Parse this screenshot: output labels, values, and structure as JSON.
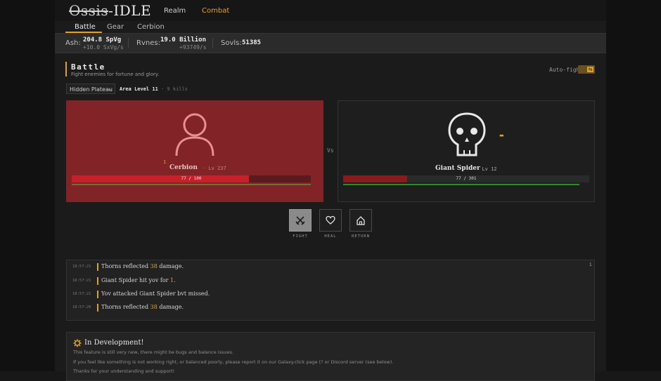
{
  "app": {
    "logo": "Ossis-IDLE",
    "logo_struck": "Ossis",
    "logo_rest": "-IDLE"
  },
  "topnav": {
    "realm": "Realm",
    "combat": "Combat"
  },
  "subtabs": {
    "battle": "Battle",
    "gear": "Gear",
    "cerbion": "Cerbion"
  },
  "resources": {
    "ash": {
      "label": "Ash:",
      "value": "204.8 SpVg",
      "rate": "+10.0 SxVg/s"
    },
    "runes": {
      "label": "Rvnes:",
      "value": "19.0 Billion",
      "rate": "+93749/s"
    },
    "souls": {
      "label": "Sovls:",
      "value": "51385"
    }
  },
  "battle": {
    "title": "Battle",
    "subtitle": "Fight enemies for fortune and glory.",
    "autofight_label": "Auto-fight:",
    "area": "Hidden Plateau",
    "area_level": "Area Level 11",
    "area_kills": "· 9 kills",
    "vs": "Vs"
  },
  "player": {
    "name": "Cerbion",
    "level": "· Lv 237",
    "hp_text": "77 / 100",
    "hp_fraction": 0.74,
    "marker": "1"
  },
  "enemy": {
    "name": "Giant Spider",
    "level": "· Lv 12",
    "hp_text": "77 / 301",
    "hp_fraction": 0.26
  },
  "actions": {
    "fight": "FIGHT",
    "heal": "HEAL",
    "return": "RETURN"
  },
  "log": [
    {
      "time": "18:57:21",
      "pre": "Thorns reflected ",
      "hi": "38",
      "post": " damage."
    },
    {
      "time": "18:57:21",
      "pre": "Giant Spider hit yov for ",
      "hi": "1",
      "post": "."
    },
    {
      "time": "18:57:21",
      "pre": "Yov attacked Giant Spider bvt missed.",
      "hi": "",
      "post": ""
    },
    {
      "time": "18:57:20",
      "pre": "Thorns reflected ",
      "hi": "38",
      "post": " damage."
    }
  ],
  "dev": {
    "title": "In Development!",
    "line1": "This feature is still very new, there might be bugs and balance issues.",
    "line2": "If you feel like something is not working right, or balanced poorly, please report it on our Galaxy.click page (? or Discord server (see below).",
    "line3": "Thanks for your understanding and support!"
  },
  "colors": {
    "accent": "#e0a030",
    "player_panel": "#822328",
    "hp_red": "#c8202a",
    "hp_green": "#2f8a2f"
  },
  "icons": {
    "player": "user-icon",
    "enemy": "skull-icon",
    "fight": "crossed-swords-icon",
    "heal": "heart-icon",
    "return": "home-icon",
    "dev": "gear-icon"
  }
}
